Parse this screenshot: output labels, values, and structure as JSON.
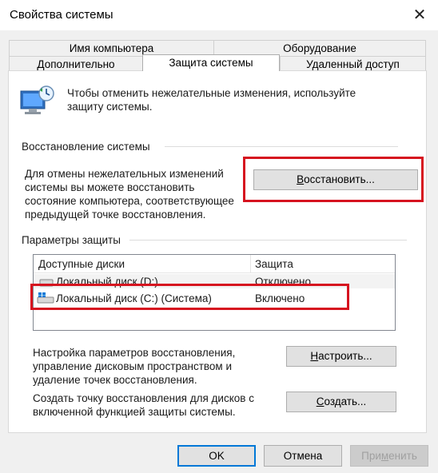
{
  "window": {
    "title": "Свойства системы",
    "close_glyph": "✕"
  },
  "tabs": {
    "row1": [
      "Имя компьютера",
      "Оборудование"
    ],
    "row2": [
      "Дополнительно",
      "Защита системы",
      "Удаленный доступ"
    ],
    "active": "Защита системы"
  },
  "intro": {
    "line1": "Чтобы отменить нежелательные изменения, используйте",
    "line2": "защиту системы."
  },
  "restore_group": {
    "label": "Восстановление системы",
    "desc": [
      "Для отмены нежелательных изменений",
      "системы вы можете восстановить",
      "состояние компьютера, соответствующее",
      "предыдущей точке восстановления."
    ],
    "button_u": "В",
    "button_rest": "осстановить..."
  },
  "protection_group": {
    "label": "Параметры защиты",
    "columns": [
      "Доступные диски",
      "Защита"
    ],
    "drives": [
      {
        "name": "Локальный диск (D:)",
        "status": "Отключено"
      },
      {
        "name": "Локальный диск (C:) (Система)",
        "status": "Включено"
      }
    ],
    "configure_desc": [
      "Настройка параметров восстановления,",
      "управление дисковым пространством и",
      "удаление точек восстановления."
    ],
    "configure_u": "Н",
    "configure_rest": "астроить...",
    "create_desc": [
      "Создать точку восстановления для дисков с",
      "включенной функцией защиты системы."
    ],
    "create_u": "С",
    "create_rest": "оздать..."
  },
  "footer": {
    "ok": "OK",
    "cancel": "Отмена",
    "apply_pre": "При",
    "apply_u": "м",
    "apply_post": "енить"
  },
  "highlight_color": "#d6131f",
  "accent_color": "#0078d7"
}
